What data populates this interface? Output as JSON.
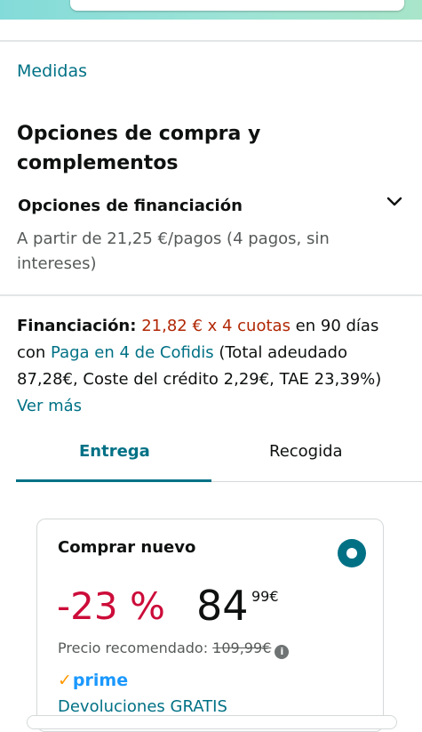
{
  "measures_link": "Medidas",
  "purchase_options": {
    "title": "Opciones de compra y complementos",
    "financing_header": "Opciones de financiación",
    "financing_description": "A partir de 21,25 €/pagos (4 pagos, sin intereses)",
    "expand_icon": "chevron-down-icon"
  },
  "financing": {
    "label": "Financiación:",
    "installments": "21,82 € x 4 cuotas",
    "days_text": " en 90 días con ",
    "provider_link": "Paga en 4 de Cofidis",
    "details": " (Total adeudado 87,28€, Coste del crédito 2,29€, TAE 23,39%) ",
    "more_link": "Ver más"
  },
  "tabs": [
    {
      "label": "Entrega",
      "selected": true
    },
    {
      "label": "Recogida",
      "selected": false
    }
  ],
  "offer": {
    "title": "Comprar nuevo",
    "discount": "-23 %",
    "price_whole": "84",
    "price_fraction": "99",
    "currency": "€",
    "recommended_label": "Precio recomendado: ",
    "recommended_price": "109,99€",
    "prime_check": "✓",
    "prime_label": "prime",
    "returns": "Devoluciones GRATIS"
  },
  "colors": {
    "link": "#007185",
    "price_red": "#b12704",
    "discount": "#cc0c39",
    "prime_blue": "#1a98ff",
    "prime_check": "#ff9900"
  }
}
